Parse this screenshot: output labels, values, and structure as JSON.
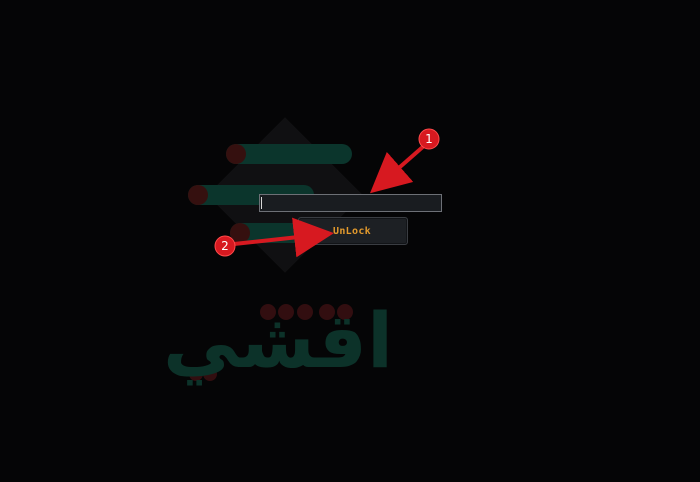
{
  "password_input": {
    "value": "",
    "placeholder": ""
  },
  "unlock_button": {
    "label": "UnLock"
  },
  "annotations": [
    {
      "number": "1"
    },
    {
      "number": "2"
    }
  ],
  "watermark": {
    "text": "اقشي"
  },
  "colors": {
    "background": "#050506",
    "button_text": "#e39a2d",
    "marker": "#d71920",
    "watermark_green": "#0d332b",
    "watermark_red": "#3b0d10"
  }
}
